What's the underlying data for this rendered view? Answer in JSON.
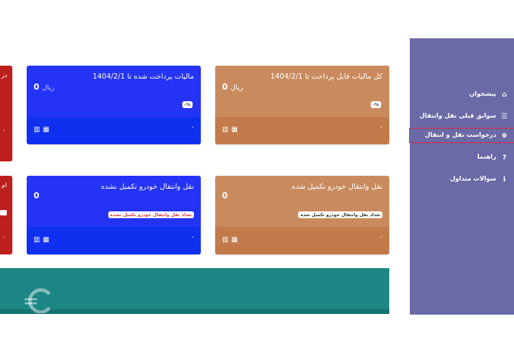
{
  "sidebar": {
    "items": [
      {
        "label": "پیشخوان",
        "icon": "home-icon"
      },
      {
        "label": "سوابق قبلی نقل وانتقال",
        "icon": "list-icon"
      },
      {
        "label": "درخواست نقل و انتقال",
        "icon": "plus-circle-icon",
        "selected": true
      },
      {
        "label": "راهنما",
        "icon": "question-icon"
      },
      {
        "label": "سوالات متداول",
        "icon": "info-icon"
      }
    ]
  },
  "cards": [
    {
      "title": "کل مالیات قابل پرداخت تا 1404/2/1",
      "value": "0",
      "unit": "ریال",
      "badge": "%-",
      "dash": "-"
    },
    {
      "title": "مالیات پرداخت شده تا 1404/2/1",
      "value": "0",
      "unit": "ریال",
      "badge": "%-",
      "dash": "-"
    },
    {
      "title": "نقل وانتقال خودرو تکمیل شده",
      "value": "0",
      "badge": "تعداد نقل وانتقال خودرو تکمیل شده",
      "dash": "-"
    },
    {
      "title": "نقل وانتقال خودرو تکمیل نشده",
      "value": "0",
      "badge": "تعداد نقل وانتقال خودرو تکمیل نشده",
      "dash": "-"
    }
  ],
  "partial_cards": [
    {
      "title": "در",
      "dash": "-"
    },
    {
      "title": "ام",
      "dash": "-"
    }
  ],
  "colors": {
    "sidebar": "#6a6aa6",
    "card_tan": "#c98b5e",
    "card_tan_bottom": "#c27a4a",
    "card_blue": "#2433f5",
    "card_blue_bottom": "#1030f0",
    "card_red": "#bd1e1e",
    "banner": "#1c8784",
    "selection": "#e0233b"
  }
}
